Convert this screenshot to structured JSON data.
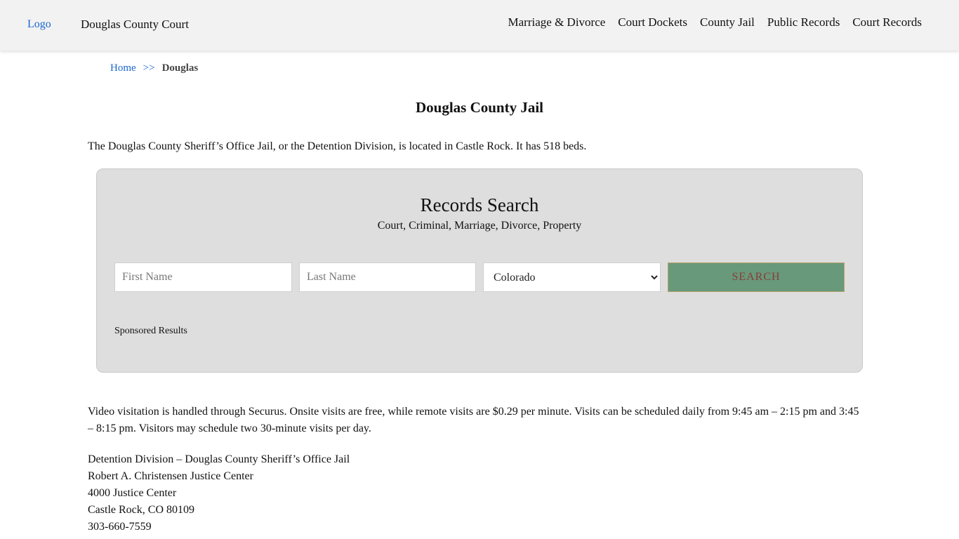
{
  "header": {
    "logo_alt": "Logo",
    "site_title": "Douglas County Court",
    "nav": [
      "Marriage & Divorce",
      "Court Dockets",
      "County Jail",
      "Public Records",
      "Court Records"
    ]
  },
  "breadcrumb": {
    "home": "Home",
    "separator": ">>",
    "current": "Douglas"
  },
  "main": {
    "title": "Douglas County Jail",
    "intro": "The Douglas County Sheriff’s Office Jail, or the Detention Division, is located in Castle Rock. It has 518 beds."
  },
  "search": {
    "heading": "Records Search",
    "subheading": "Court, Criminal, Marriage, Divorce, Property",
    "first_name_placeholder": "First Name",
    "last_name_placeholder": "Last Name",
    "state_selected": "Colorado",
    "button_label": "SEARCH",
    "sponsored": "Sponsored Results"
  },
  "visitation": "Video visitation is handled through Securus. Onsite visits are free, while remote visits are $0.29 per minute. Visits can be scheduled daily from 9:45 am – 2:15 pm and 3:45 – 8:15 pm. Visitors may schedule two 30-minute visits per day.",
  "address": {
    "line1": "Detention Division – Douglas County Sheriff’s Office Jail",
    "line2": "Robert A. Christensen Justice Center",
    "line3": "4000 Justice Center",
    "line4": "Castle Rock, CO 80109",
    "phone": "303-660-7559"
  },
  "colors": {
    "header_bg": "#f2f2f2",
    "link": "#1a66cc",
    "search_panel_bg": "#dedede",
    "search_button_bg": "#68997a",
    "search_button_text": "#8a3b3b"
  }
}
